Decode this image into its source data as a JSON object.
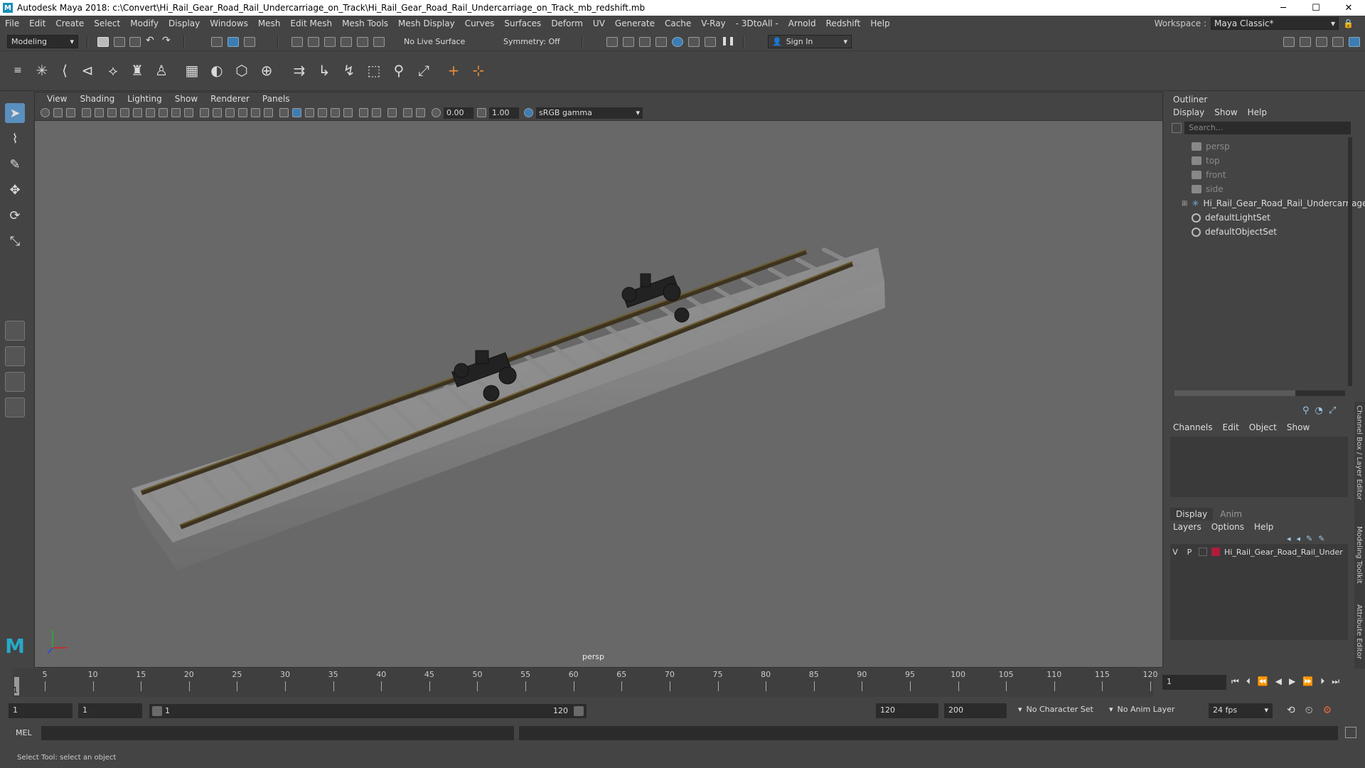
{
  "window": {
    "title": "Autodesk Maya 2018: c:\\Convert\\Hi_Rail_Gear_Road_Rail_Undercarriage_on_Track\\Hi_Rail_Gear_Road_Rail_Undercarriage_on_Track_mb_redshift.mb",
    "app_icon": "M",
    "minimize": "─",
    "maximize": "☐",
    "close": "✕"
  },
  "menu": [
    "File",
    "Edit",
    "Create",
    "Select",
    "Modify",
    "Display",
    "Windows",
    "Mesh",
    "Edit Mesh",
    "Mesh Tools",
    "Mesh Display",
    "Curves",
    "Surfaces",
    "Deform",
    "UV",
    "Generate",
    "Cache",
    "V-Ray",
    "- 3DtoAll -",
    "Arnold",
    "Redshift",
    "Help"
  ],
  "workspace": {
    "label": "Workspace :",
    "value": "Maya Classic*"
  },
  "statusline": {
    "mode": "Modeling",
    "live_surface": "No Live Surface",
    "symmetry": "Symmetry: Off",
    "sign_in": "Sign In"
  },
  "viewport": {
    "menu": [
      "View",
      "Shading",
      "Lighting",
      "Show",
      "Renderer",
      "Panels"
    ],
    "exposure": "0.00",
    "gamma": "1.00",
    "color_space": "sRGB gamma",
    "camera_label": "persp"
  },
  "outliner": {
    "title": "Outliner",
    "menu": [
      "Display",
      "Show",
      "Help"
    ],
    "search_placeholder": "Search...",
    "items": [
      {
        "label": "persp",
        "type": "camera",
        "dim": true
      },
      {
        "label": "top",
        "type": "camera",
        "dim": true
      },
      {
        "label": "front",
        "type": "camera",
        "dim": true
      },
      {
        "label": "side",
        "type": "camera",
        "dim": true
      },
      {
        "label": "Hi_Rail_Gear_Road_Rail_Undercarriage_o",
        "type": "group",
        "dim": false
      },
      {
        "label": "defaultLightSet",
        "type": "set",
        "dim": false
      },
      {
        "label": "defaultObjectSet",
        "type": "set",
        "dim": false
      }
    ]
  },
  "channelbox": {
    "menu": [
      "Channels",
      "Edit",
      "Object",
      "Show"
    ]
  },
  "layers": {
    "tabs": [
      "Display",
      "Anim"
    ],
    "menu": [
      "Layers",
      "Options",
      "Help"
    ],
    "row": {
      "v": "V",
      "p": "P",
      "name": "Hi_Rail_Gear_Road_Rail_Under",
      "color": "#b01c3c"
    }
  },
  "side_tabs": [
    "Channel Box / Layer Editor",
    "Modeling Toolkit",
    "Attribute Editor"
  ],
  "timeline": {
    "ticks": [
      "5",
      "10",
      "15",
      "20",
      "25",
      "30",
      "35",
      "40",
      "45",
      "50",
      "55",
      "60",
      "65",
      "70",
      "75",
      "80",
      "85",
      "90",
      "95",
      "100",
      "105",
      "110",
      "115",
      "120"
    ],
    "current_frame_marker": "1",
    "current_frame_field": "1"
  },
  "range": {
    "start": "1",
    "anim_start": "1",
    "slider_start": "1",
    "slider_end": "120",
    "playback_end": "120",
    "anim_end": "200",
    "character_set": "No Character Set",
    "anim_layer": "No Anim Layer",
    "fps": "24 fps"
  },
  "command": {
    "label": "MEL"
  },
  "help_line": "Select Tool: select an object"
}
